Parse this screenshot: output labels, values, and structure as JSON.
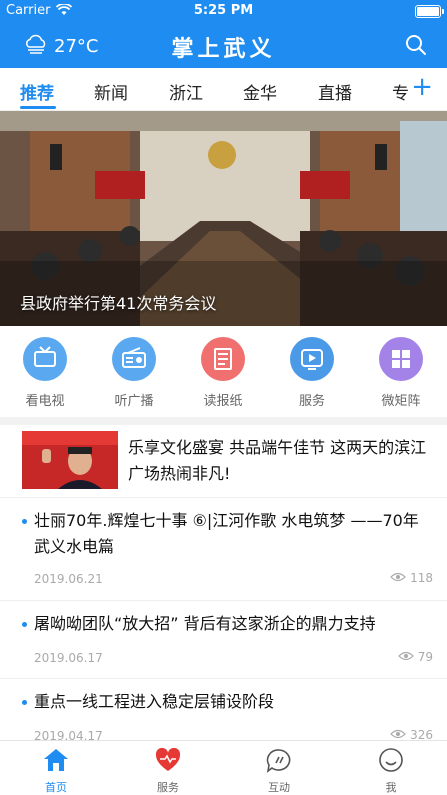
{
  "status_bar": {
    "carrier": "Carrier",
    "time": "5:25 PM"
  },
  "header": {
    "temperature": "27°C",
    "app_title": "掌上武义"
  },
  "tabs": [
    {
      "label": "推荐"
    },
    {
      "label": "新闻"
    },
    {
      "label": "浙江"
    },
    {
      "label": "金华"
    },
    {
      "label": "直播"
    },
    {
      "label": "专"
    }
  ],
  "banner": {
    "caption": "县政府举行第41次常务会议"
  },
  "quick_links": [
    {
      "label": "看电视",
      "color": "#5aa8f0"
    },
    {
      "label": "听广播",
      "color": "#5aa8f0"
    },
    {
      "label": "读报纸",
      "color": "#f07070"
    },
    {
      "label": "服务",
      "color": "#4a9ae8"
    },
    {
      "label": "微矩阵",
      "color": "#a483e8"
    }
  ],
  "featured": {
    "title": "乐享文化盛宴 共品端午佳节 这两天的滨江广场热闹非凡!"
  },
  "news": [
    {
      "title": "壮丽70年.辉煌七十事 ⑥|江河作歌 水电筑梦 ——70年武义水电篇",
      "date": "2019.06.21",
      "views": "118"
    },
    {
      "title": "屠呦呦团队“放大招” 背后有这家浙企的鼎力支持",
      "date": "2019.06.17",
      "views": "79"
    },
    {
      "title": "重点一线工程进入稳定层铺设阶段",
      "date": "2019.04.17",
      "views": "326"
    }
  ],
  "bottom_nav": [
    {
      "label": "首页"
    },
    {
      "label": "服务"
    },
    {
      "label": "互动"
    },
    {
      "label": "我"
    }
  ],
  "colors": {
    "brand": "#1e8cf0",
    "divider": "#f2f2f2"
  }
}
